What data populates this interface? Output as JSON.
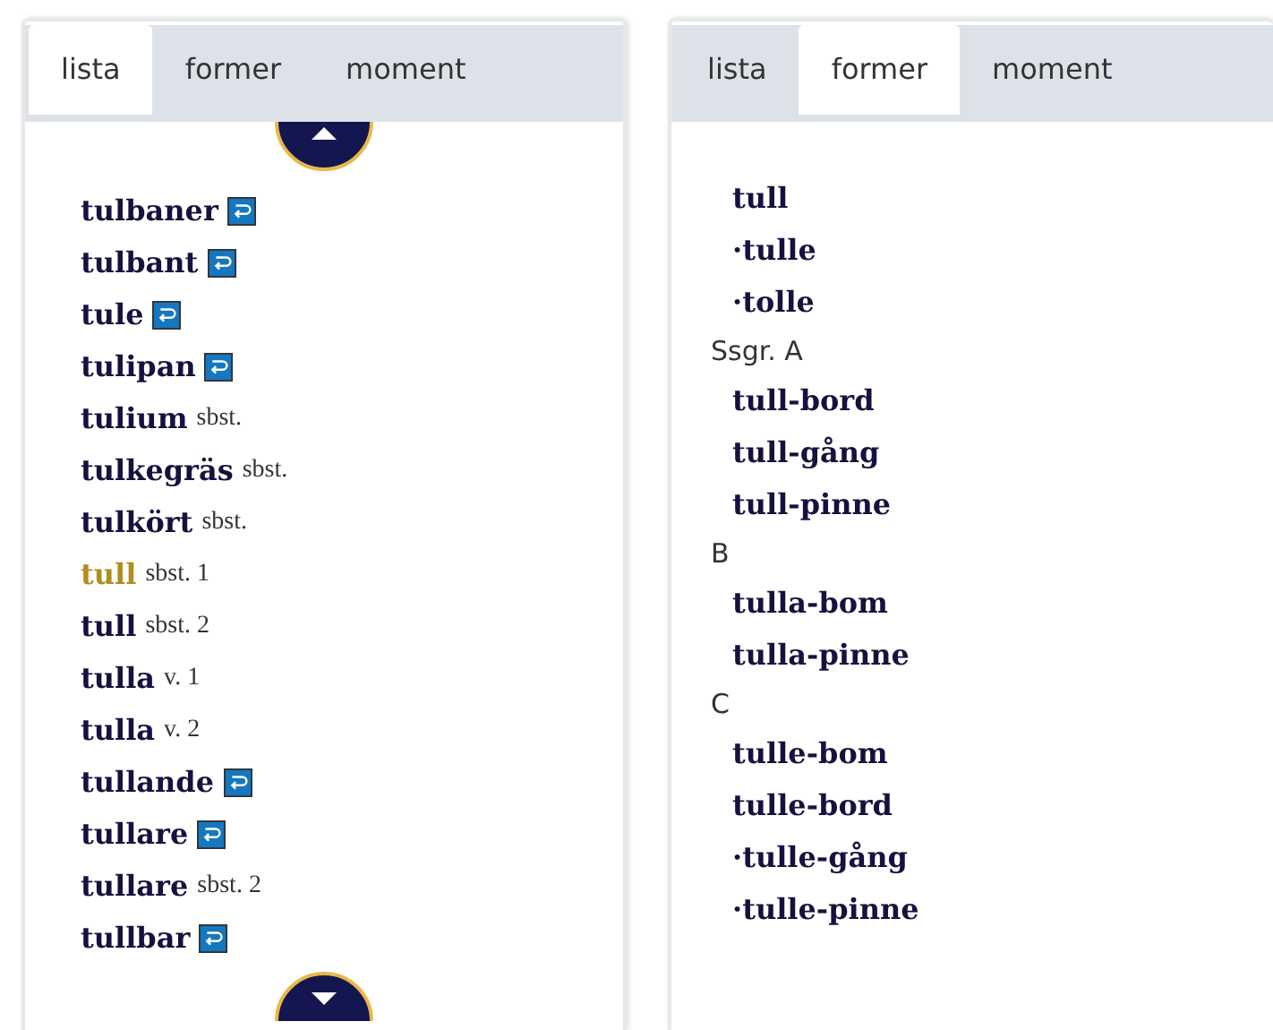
{
  "left_panel": {
    "tabs": [
      {
        "label": "lista",
        "selected": true
      },
      {
        "label": "former",
        "selected": false
      },
      {
        "label": "moment",
        "selected": false
      }
    ],
    "entries": [
      {
        "word": "tulbaner",
        "link": true,
        "selected": false
      },
      {
        "word": "tulbant",
        "link": true,
        "selected": false
      },
      {
        "word": "tule",
        "link": true,
        "selected": false
      },
      {
        "word": "tulipan",
        "link": true,
        "selected": false
      },
      {
        "word": "tulium",
        "pos": "sbst.",
        "link": false,
        "selected": false
      },
      {
        "word": "tulkegräs",
        "pos": "sbst.",
        "link": false,
        "selected": false
      },
      {
        "word": "tulkört",
        "pos": "sbst.",
        "link": false,
        "selected": false
      },
      {
        "word": "tull",
        "pos": "sbst. 1",
        "link": false,
        "selected": true
      },
      {
        "word": "tull",
        "pos": "sbst. 2",
        "link": false,
        "selected": false
      },
      {
        "word": "tulla",
        "pos": "v. 1",
        "link": false,
        "selected": false
      },
      {
        "word": "tulla",
        "pos": "v. 2",
        "link": false,
        "selected": false
      },
      {
        "word": "tullande",
        "link": true,
        "selected": false
      },
      {
        "word": "tullare",
        "link": true,
        "selected": false
      },
      {
        "word": "tullare",
        "pos": "sbst. 2",
        "link": false,
        "selected": false
      },
      {
        "word": "tullbar",
        "link": true,
        "selected": false
      }
    ]
  },
  "right_panel": {
    "tabs": [
      {
        "label": "lista",
        "selected": false
      },
      {
        "label": "former",
        "selected": true
      },
      {
        "label": "moment",
        "selected": false
      }
    ],
    "forms": [
      {
        "kind": "form",
        "text": "tull"
      },
      {
        "kind": "form",
        "text": "·tulle"
      },
      {
        "kind": "form",
        "text": "·tolle"
      },
      {
        "kind": "heading",
        "text": "Ssgr. A"
      },
      {
        "kind": "form",
        "text": "tull-bord"
      },
      {
        "kind": "form",
        "text": "tull-gång"
      },
      {
        "kind": "form",
        "text": "tull-pinne"
      },
      {
        "kind": "heading",
        "text": "B"
      },
      {
        "kind": "form",
        "text": "tulla-bom"
      },
      {
        "kind": "form",
        "text": "tulla-pinne"
      },
      {
        "kind": "heading",
        "text": "C"
      },
      {
        "kind": "form",
        "text": "tulle-bom"
      },
      {
        "kind": "form",
        "text": "tulle-bord"
      },
      {
        "kind": "form",
        "text": "·tulle-gång"
      },
      {
        "kind": "form",
        "text": "·tulle-pinne"
      }
    ]
  }
}
